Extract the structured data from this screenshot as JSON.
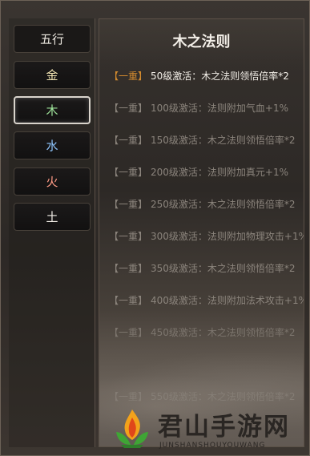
{
  "tabs": {
    "header": "五行",
    "items": [
      {
        "label": "金",
        "color": "#f3e6b4"
      },
      {
        "label": "木",
        "color": "#9ee39a"
      },
      {
        "label": "水",
        "color": "#8fc6ff"
      },
      {
        "label": "火",
        "color": "#ff9b86"
      },
      {
        "label": "土",
        "color": "#f1ede6"
      }
    ],
    "active_index": 1
  },
  "panel": {
    "title": "木之法则",
    "rows": [
      {
        "tier": "【一重】",
        "text": "50级激活：木之法则领悟倍率*2",
        "state": "on"
      },
      {
        "tier": "【一重】",
        "text": "100级激活：法则附加气血+1%",
        "state": "off"
      },
      {
        "tier": "【一重】",
        "text": "150级激活：木之法则领悟倍率*2",
        "state": "off"
      },
      {
        "tier": "【一重】",
        "text": "200级激活：法则附加真元+1%",
        "state": "off"
      },
      {
        "tier": "【一重】",
        "text": "250级激活：木之法则领悟倍率*2",
        "state": "off"
      },
      {
        "tier": "【一重】",
        "text": "300级激活：法则附加物理攻击+1%",
        "state": "off"
      },
      {
        "tier": "【一重】",
        "text": "350级激活：木之法则领悟倍率*2",
        "state": "off"
      },
      {
        "tier": "【一重】",
        "text": "400级激活：法则附加法术攻击+1%",
        "state": "off"
      },
      {
        "tier": "【一重】",
        "text": "450级激活：木之法则领悟倍率*2",
        "state": "faded"
      },
      {
        "tier": "【一重】",
        "text": "550级激活：木之法则领悟倍率*2",
        "state": "faded"
      }
    ]
  },
  "watermark": {
    "name": "君山手游网",
    "sub": "JUNSHANSHOUYOUWANG"
  }
}
